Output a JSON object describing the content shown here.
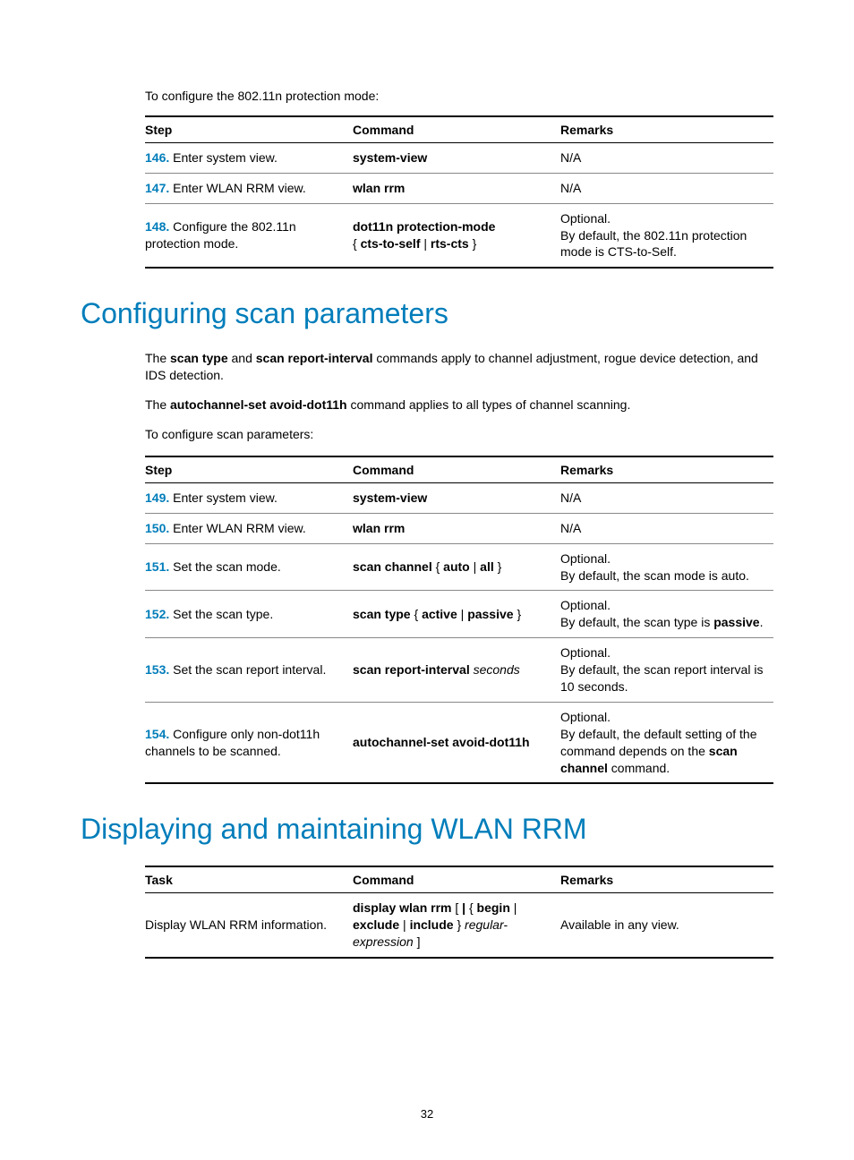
{
  "intro1": "To configure the 802.11n protection mode:",
  "table1": {
    "headers": [
      "Step",
      "Command",
      "Remarks"
    ],
    "rows": [
      {
        "num": "146.",
        "step": "Enter system view.",
        "cmd_bold": "system-view",
        "rem_plain": "N/A"
      },
      {
        "num": "147.",
        "step": "Enter WLAN RRM view.",
        "cmd_bold": "wlan rrm",
        "rem_plain": "N/A"
      },
      {
        "num": "148.",
        "step": "Configure the 802.11n protection mode.",
        "cmd_html": "<span class=\"bold\">dot11n protection-mode</span><br>{ <span class=\"bold\">cts-to-self</span> | <span class=\"bold\">rts-cts</span> }",
        "rem_html": "Optional.<br>By default, the 802.11n protection mode is CTS-to-Self."
      }
    ]
  },
  "heading1": "Configuring scan parameters",
  "para1_html": "The <span class=\"bold\">scan type</span> and <span class=\"bold\">scan report-interval</span> commands apply to channel adjustment, rogue device detection, and IDS detection.",
  "para2_html": "The <span class=\"bold\">autochannel-set avoid-dot11h</span> command applies to all types of channel scanning.",
  "para3": "To configure scan parameters:",
  "table2": {
    "headers": [
      "Step",
      "Command",
      "Remarks"
    ],
    "rows": [
      {
        "num": "149.",
        "step": "Enter system view.",
        "cmd_bold": "system-view",
        "rem_plain": "N/A"
      },
      {
        "num": "150.",
        "step": "Enter WLAN RRM view.",
        "cmd_bold": "wlan rrm",
        "rem_plain": "N/A"
      },
      {
        "num": "151.",
        "step": "Set the scan mode.",
        "cmd_html": "<span class=\"bold\">scan channel</span> { <span class=\"bold\">auto</span> | <span class=\"bold\">all</span> }",
        "rem_html": "Optional.<br>By default, the scan mode is auto."
      },
      {
        "num": "152.",
        "step": "Set the scan type.",
        "cmd_html": "<span class=\"bold\">scan type</span> { <span class=\"bold\">active</span> | <span class=\"bold\">passive</span> }",
        "rem_html": "Optional.<br>By default, the scan type is <span class=\"bold\">passive</span>."
      },
      {
        "num": "153.",
        "step": "Set the scan report interval.",
        "cmd_html": "<span class=\"bold\">scan report-interval</span> <span class=\"ital\">seconds</span>",
        "rem_html": "Optional.<br>By default, the scan report interval is 10 seconds."
      },
      {
        "num": "154.",
        "step": "Configure only non-dot11h channels to be scanned.",
        "cmd_html": "<span class=\"bold\">autochannel-set avoid-dot11h</span>",
        "rem_html": "Optional.<br>By default, the default setting of the command depends on the <span class=\"bold\">scan channel</span> command."
      }
    ]
  },
  "heading2": "Displaying and maintaining WLAN RRM",
  "table3": {
    "headers": [
      "Task",
      "Command",
      "Remarks"
    ],
    "rows": [
      {
        "task": "Display WLAN RRM information.",
        "cmd_html": "<span class=\"bold\">display wlan rrm</span> [ <span class=\"bold\">|</span> { <span class=\"bold\">begin</span> | <span class=\"bold\">exclude</span> | <span class=\"bold\">include</span> } <span class=\"ital\">regular-expression</span> ]",
        "rem_plain": "Available in any view."
      }
    ]
  },
  "pagenum": "32"
}
